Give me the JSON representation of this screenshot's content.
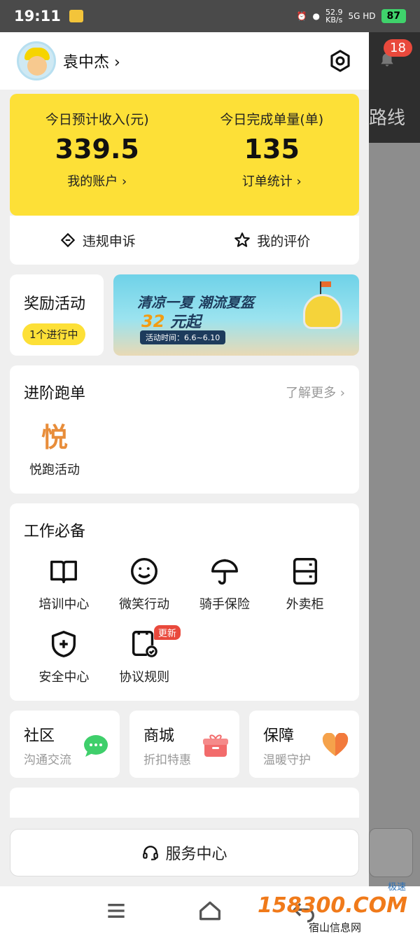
{
  "status_bar": {
    "time": "19:11",
    "speed_value": "52.9",
    "speed_unit": "KB/s",
    "network": "5G HD",
    "battery": "87"
  },
  "background": {
    "notification_count": "18",
    "route_label": "路线"
  },
  "profile": {
    "name": "袁中杰",
    "chevron": "›"
  },
  "earnings": {
    "income_label": "今日预计收入(元)",
    "income_value": "339.5",
    "account_link": "我的账户 ›",
    "orders_label": "今日完成单量(单)",
    "orders_value": "135",
    "orders_link": "订单统计 ›"
  },
  "quick_links": {
    "appeal": "违规申诉",
    "rating": "我的评价"
  },
  "rewards": {
    "title": "奖励活动",
    "badge": "1个进行中"
  },
  "banner": {
    "headline": "清凉一夏 潮流夏盔",
    "price_num": "32",
    "price_suffix": "元起",
    "date": "活动时间：6.6~6.10"
  },
  "advanced": {
    "title": "进阶跑单",
    "more": "了解更多 ›",
    "item_icon_text": "悦",
    "item_label": "悦跑活动"
  },
  "work": {
    "title": "工作必备",
    "items": [
      {
        "label": "培训中心",
        "icon": "book-icon"
      },
      {
        "label": "微笑行动",
        "icon": "smile-icon"
      },
      {
        "label": "骑手保险",
        "icon": "umbrella-icon"
      },
      {
        "label": "外卖柜",
        "icon": "locker-icon"
      },
      {
        "label": "安全中心",
        "icon": "shield-plus-icon"
      },
      {
        "label": "协议规则",
        "icon": "document-check-icon",
        "badge": "更新"
      }
    ]
  },
  "tri_cards": [
    {
      "title": "社区",
      "sub": "沟通交流",
      "icon": "chat-bubble-icon",
      "color": "#3fcf6b"
    },
    {
      "title": "商城",
      "sub": "折扣特惠",
      "icon": "gift-box-icon",
      "color": "#f26b6b"
    },
    {
      "title": "保障",
      "sub": "温暖守护",
      "icon": "heart-icon",
      "color": "#f5a24b"
    }
  ],
  "service": {
    "label": "服务中心"
  },
  "watermark": {
    "main": "158300.COM",
    "tag": "极速",
    "sub": "宿山信息网"
  },
  "colors": {
    "accent_yellow": "#fde037",
    "badge_red": "#e9493c",
    "orange": "#e88d3a"
  }
}
